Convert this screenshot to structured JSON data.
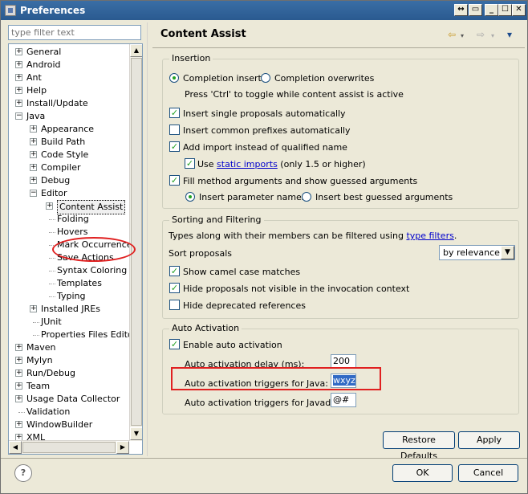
{
  "window": {
    "title": "Preferences",
    "buttons": {
      "menu": "↔",
      "restore_left": "▭",
      "minimize": "_",
      "maximize": "☐",
      "close": "✕"
    }
  },
  "filter": {
    "placeholder": "type filter text"
  },
  "tree": {
    "items": [
      {
        "label": "General",
        "level": 0,
        "expander": "+"
      },
      {
        "label": "Android",
        "level": 0,
        "expander": "+"
      },
      {
        "label": "Ant",
        "level": 0,
        "expander": "+"
      },
      {
        "label": "Help",
        "level": 0,
        "expander": "+"
      },
      {
        "label": "Install/Update",
        "level": 0,
        "expander": "+"
      },
      {
        "label": "Java",
        "level": 0,
        "expander": "−"
      },
      {
        "label": "Appearance",
        "level": 1,
        "expander": "+"
      },
      {
        "label": "Build Path",
        "level": 1,
        "expander": "+"
      },
      {
        "label": "Code Style",
        "level": 1,
        "expander": "+"
      },
      {
        "label": "Compiler",
        "level": 1,
        "expander": "+"
      },
      {
        "label": "Debug",
        "level": 1,
        "expander": "+"
      },
      {
        "label": "Editor",
        "level": 1,
        "expander": "−"
      },
      {
        "label": "Content Assist",
        "level": 2,
        "expander": "+",
        "selected": true
      },
      {
        "label": "Folding",
        "level": 2
      },
      {
        "label": "Hovers",
        "level": 2
      },
      {
        "label": "Mark Occurrences",
        "level": 2
      },
      {
        "label": "Save Actions",
        "level": 2
      },
      {
        "label": "Syntax Coloring",
        "level": 2
      },
      {
        "label": "Templates",
        "level": 2
      },
      {
        "label": "Typing",
        "level": 2
      },
      {
        "label": "Installed JREs",
        "level": 1,
        "expander": "+"
      },
      {
        "label": "JUnit",
        "level": 1
      },
      {
        "label": "Properties Files Editor",
        "level": 1
      },
      {
        "label": "Maven",
        "level": 0,
        "expander": "+"
      },
      {
        "label": "Mylyn",
        "level": 0,
        "expander": "+"
      },
      {
        "label": "Run/Debug",
        "level": 0,
        "expander": "+"
      },
      {
        "label": "Team",
        "level": 0,
        "expander": "+"
      },
      {
        "label": "Usage Data Collector",
        "level": 0,
        "expander": "+"
      },
      {
        "label": "Validation",
        "level": 0
      },
      {
        "label": "WindowBuilder",
        "level": 0,
        "expander": "+"
      },
      {
        "label": "XML",
        "level": 0,
        "expander": "+"
      }
    ]
  },
  "page": {
    "title": "Content Assist",
    "nav": {
      "back": "⇦",
      "forward": "⇨",
      "menu": "▾"
    }
  },
  "insertion": {
    "title": "Insertion",
    "completion_inserts": "Completion inserts",
    "completion_overwrites": "Completion overwrites",
    "toggle_hint": "Press 'Ctrl' to toggle while content assist is active",
    "single_proposals": "Insert single proposals automatically",
    "common_prefixes": "Insert common prefixes automatically",
    "add_import": "Add import instead of qualified name",
    "use_prefix": "Use ",
    "static_imports_link": "static imports",
    "use_suffix": " (only 1.5 or higher)",
    "fill_args": "Fill method arguments and show guessed arguments",
    "insert_param_names": "Insert parameter names",
    "insert_best_guessed": "Insert best guessed arguments"
  },
  "sorting": {
    "title": "Sorting and Filtering",
    "desc_prefix": "Types along with their members can be filtered using ",
    "type_filters_link": "type filters",
    "desc_suffix": ".",
    "sort_label": "Sort proposals",
    "sort_value": "by relevance",
    "camel_case": "Show camel case matches",
    "hide_invocation": "Hide proposals not visible in the invocation context",
    "hide_deprecated": "Hide deprecated references"
  },
  "auto": {
    "title": "Auto Activation",
    "enable": "Enable auto activation",
    "delay_label": "Auto activation delay (ms):",
    "delay_value": "200",
    "java_label": "Auto activation triggers for Java:",
    "java_value": "wxyz",
    "javadoc_label": "Auto activation triggers for Javadoc:",
    "javadoc_value": "@#"
  },
  "buttons": {
    "restore_defaults": "Restore Defaults",
    "apply": "Apply",
    "ok": "OK",
    "cancel": "Cancel",
    "help": "?"
  },
  "colors": {
    "title_bar": "#3a6ea5",
    "annotation": "#e02020",
    "link": "#0000cc",
    "check": "#21a121",
    "selection": "#316ac5"
  }
}
